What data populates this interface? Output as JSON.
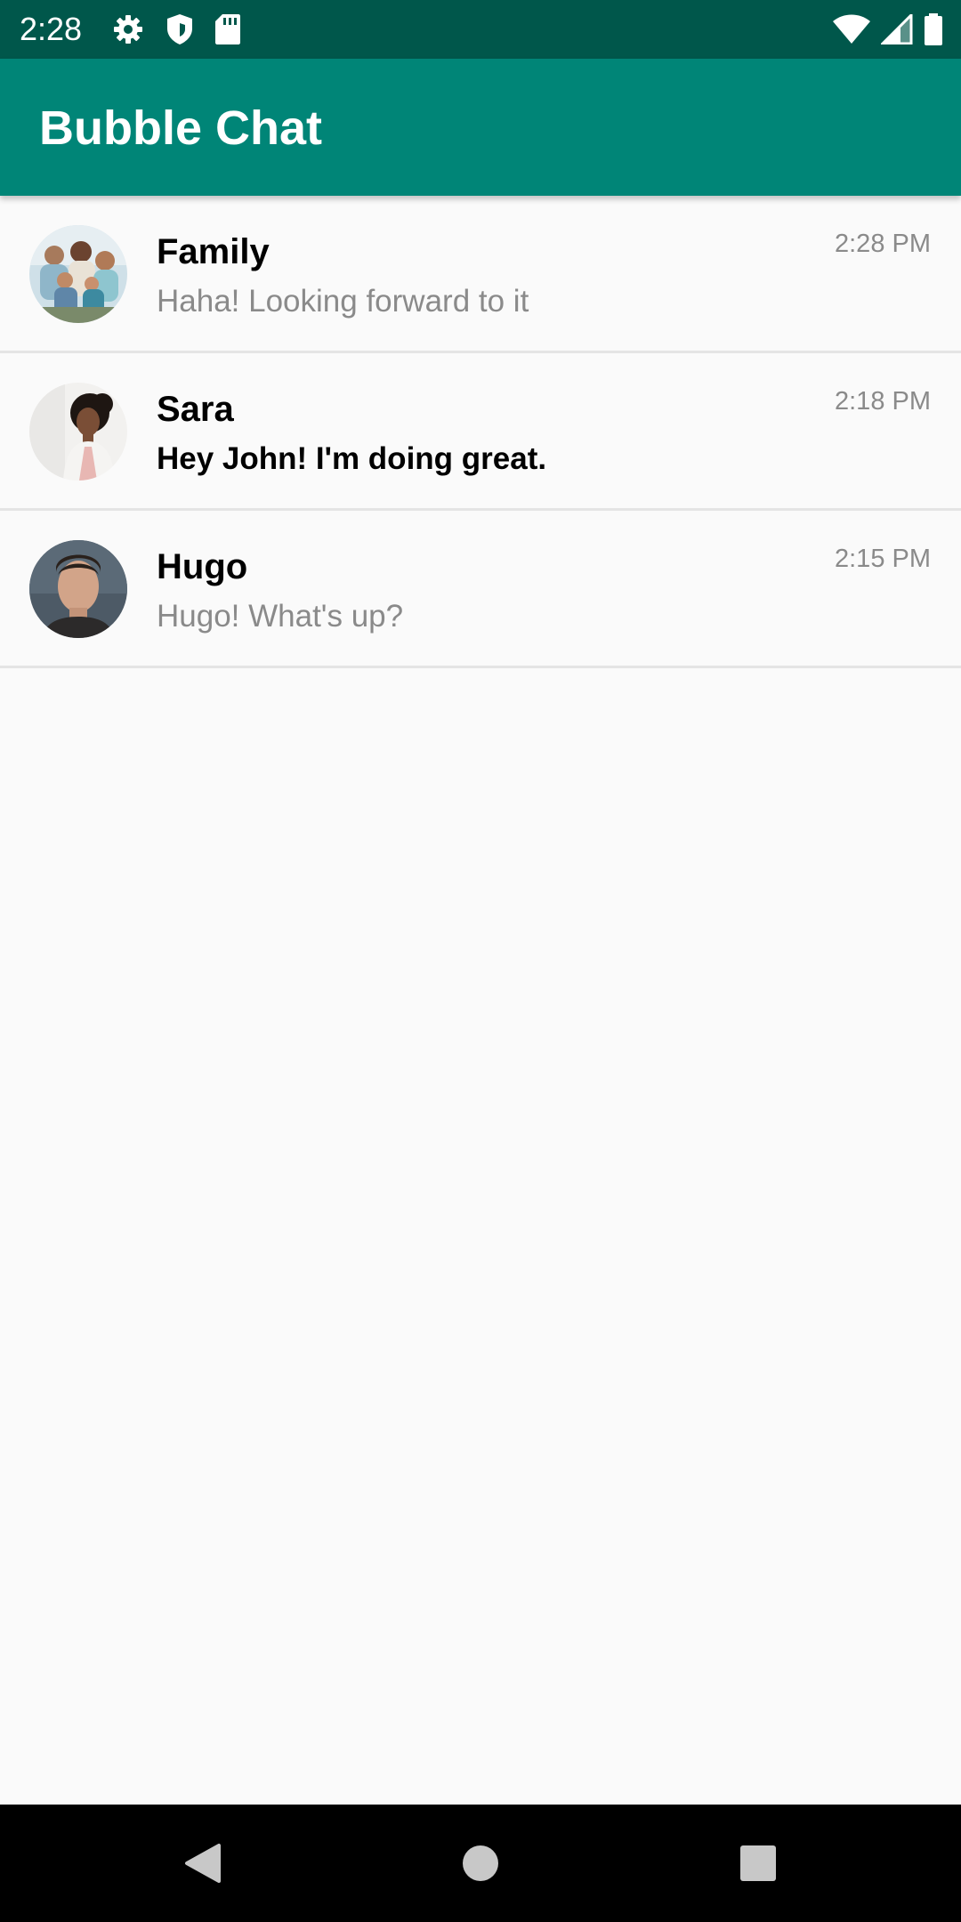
{
  "status_bar": {
    "time": "2:28",
    "left_icons": [
      "settings-icon",
      "shield-icon",
      "sd-card-icon"
    ],
    "right_icons": [
      "wifi-icon",
      "cell-signal-icon",
      "battery-icon"
    ]
  },
  "app_bar": {
    "title": "Bubble Chat",
    "color": "#008577",
    "status_color": "#00574b"
  },
  "chats": [
    {
      "name": "Family",
      "message": "Haha! Looking forward to it",
      "time": "2:28 PM",
      "unread": false,
      "avatar": "family-photo"
    },
    {
      "name": "Sara",
      "message": "Hey John! I'm doing great.",
      "time": "2:18 PM",
      "unread": true,
      "avatar": "sara-photo"
    },
    {
      "name": "Hugo",
      "message": "Hugo! What's up?",
      "time": "2:15 PM",
      "unread": false,
      "avatar": "hugo-photo"
    }
  ],
  "nav_bar": {
    "buttons": [
      "back-icon",
      "home-icon",
      "recents-icon"
    ]
  }
}
